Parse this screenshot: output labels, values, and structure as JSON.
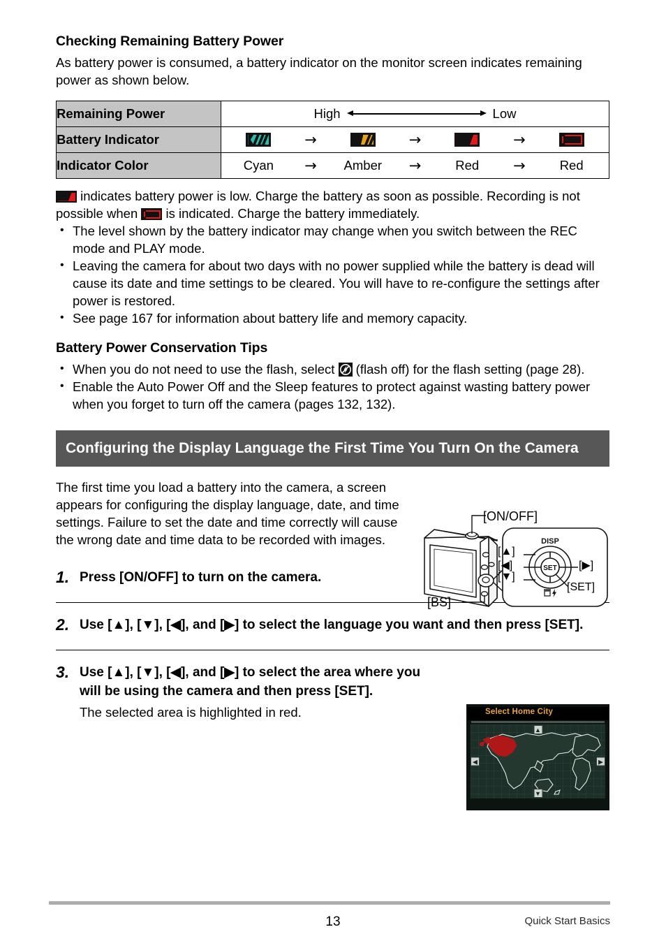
{
  "section1": {
    "heading": "Checking Remaining Battery Power",
    "intro": "As battery power is consumed, a battery indicator on the monitor screen indicates remaining power as shown below.",
    "table": {
      "rows": [
        {
          "header": "Remaining Power",
          "high_label": "High",
          "low_label": "Low"
        },
        {
          "header": "Battery Indicator",
          "icons": [
            "battery-full-cyan",
            "battery-mid-amber",
            "battery-low-red",
            "battery-empty-red"
          ],
          "arrows": [
            "→",
            "→",
            "→"
          ]
        },
        {
          "header": "Indicator Color",
          "values": [
            "Cyan",
            "Amber",
            "Red",
            "Red"
          ],
          "arrows": [
            "→",
            "→",
            "→"
          ]
        }
      ]
    },
    "note_part1": "indicates battery power is low. Charge the battery as soon as possible. Recording is not possible when",
    "note_part2": "is indicated. Charge the battery immediately.",
    "bullets": [
      "The level shown by the battery indicator may change when you switch between the REC mode and PLAY mode.",
      "Leaving the camera for about two days with no power supplied while the battery is dead will cause its date and time settings to be cleared. You will have to re-configure the settings after power is restored.",
      "See page 167 for information about battery life and memory capacity."
    ]
  },
  "section2": {
    "heading": "Battery Power Conservation Tips",
    "bullet1_a": "When you do not need to use the flash, select",
    "bullet1_b": "(flash off) for the flash setting (page 28).",
    "bullet2": "Enable the Auto Power Off and the Sleep features to protect against wasting battery power when you forget to turn off the camera (pages 132, 132)."
  },
  "section3": {
    "banner": "Configuring the Display Language the First Time You Turn On the Camera",
    "intro": "The first time you load a battery into the camera, a screen appears for configuring the display language, date, and time settings. Failure to set the date and time correctly will cause the wrong date and time data to be recorded with images.",
    "steps": [
      {
        "num": "1.",
        "text": "Press [ON/OFF] to turn on the camera."
      },
      {
        "num": "2.",
        "text": "Use [▲], [▼], [◀], and [▶] to select the language you want and then press [SET]."
      },
      {
        "num": "3.",
        "text": "Use [▲], [▼], [◀], and [▶] to select the area where you will be using the camera and then press [SET].",
        "sub": "The selected area is highlighted in red."
      }
    ]
  },
  "camera_figure": {
    "label_onoff": "[ON/OFF]",
    "label_bs": "[BS]",
    "label_set": "[SET]",
    "label_up": "[▲]",
    "label_down": "[▼]",
    "label_left": "[◀]",
    "label_right": "[▶]",
    "label_disp": "DISP",
    "label_set_center": "SET"
  },
  "map_screen": {
    "title": "Select Home City",
    "nav_up": "▲",
    "nav_down": "▼",
    "nav_left": "◀",
    "nav_right": "▶"
  },
  "footer": {
    "page_number": "13",
    "section_label": "Quick Start Basics"
  },
  "colors": {
    "table_header_bg": "#c4c4c4",
    "banner_bg": "#575757",
    "cyan": "#2bbcaa",
    "amber": "#e8a314",
    "red": "#e01b1b",
    "footer_rule": "#adadad",
    "map_title": "#e9a43c"
  }
}
